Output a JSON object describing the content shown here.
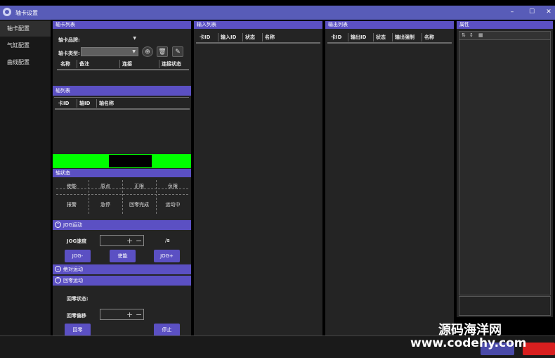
{
  "window": {
    "title": "轴卡设置",
    "controls": [
      "–",
      "☐",
      "✕"
    ]
  },
  "sidebar": {
    "items": [
      {
        "label": "轴卡配置",
        "active": true
      },
      {
        "label": "气缸配置",
        "active": false
      },
      {
        "label": "曲线配置",
        "active": false
      }
    ]
  },
  "axis_card_list": {
    "header": "轴卡列表",
    "brand_label": "轴卡品牌:",
    "brand_value": "",
    "type_label": "轴卡类型:",
    "type_value": "",
    "columns": [
      "名称",
      "备注",
      "连接",
      "连接状态"
    ]
  },
  "axis_list": {
    "header": "轴列表",
    "columns": [
      "卡ID",
      "轴ID",
      "轴名称"
    ]
  },
  "axis_status": {
    "header": "轴状态",
    "cells": [
      "使能",
      "原点",
      "正限",
      "负限",
      "报警",
      "急停",
      "回零完成",
      "运动中"
    ]
  },
  "jog": {
    "header": "JOG运动",
    "speed_label": "JOG速度",
    "speed_unit": "/s",
    "btn_minus": "JOG-",
    "btn_enable": "使能",
    "btn_plus": "JOG+"
  },
  "abs_motion": {
    "header": "绝对运动"
  },
  "homing": {
    "header": "回零运动",
    "status_label": "回零状态:",
    "offset_label": "回零偏移",
    "btn_home": "回零",
    "btn_stop": "停止"
  },
  "input_list": {
    "header": "输入列表",
    "columns": [
      "卡ID",
      "输入ID",
      "状态",
      "名称"
    ]
  },
  "output_list": {
    "header": "输出列表",
    "columns": [
      "卡ID",
      "输出ID",
      "状态",
      "输出强制",
      "名称"
    ]
  },
  "properties": {
    "header": "属性"
  },
  "watermark": {
    "line1": "源码海洋网",
    "line2": "www.codehy.com"
  },
  "colors": {
    "accent": "#5b50c3",
    "titlebar": "#585cb8",
    "green_indicator": "#00ff00",
    "red_button": "#d81f1f"
  }
}
